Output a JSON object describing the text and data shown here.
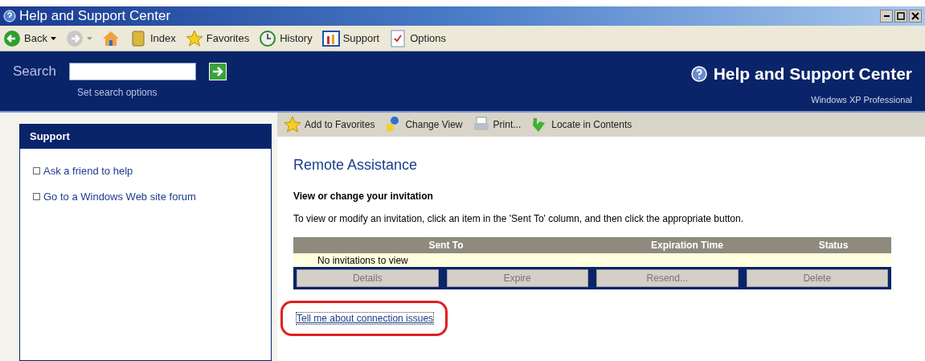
{
  "window": {
    "title": "Help and Support Center"
  },
  "toolbar": [
    {
      "kind": "back",
      "label": "Back",
      "disabled": false
    },
    {
      "kind": "forward",
      "disabled": true
    },
    {
      "kind": "home",
      "disabled": false
    },
    {
      "kind": "index",
      "label": "Index",
      "disabled": false
    },
    {
      "kind": "favorites",
      "label": "Favorites",
      "disabled": false
    },
    {
      "kind": "history",
      "label": "History",
      "disabled": false
    },
    {
      "kind": "support",
      "label": "Support",
      "disabled": false
    },
    {
      "kind": "options",
      "label": "Options",
      "disabled": false
    }
  ],
  "search": {
    "label": "Search",
    "options_link": "Set search options"
  },
  "brand": {
    "title": "Help and Support Center",
    "subtitle": "Windows XP Professional"
  },
  "sidebar": {
    "title": "Support",
    "items": [
      "Ask a friend to help",
      "Go to a Windows Web site forum"
    ]
  },
  "content_toolbar": [
    {
      "kind": "add-favorite",
      "label": "Add to Favorites"
    },
    {
      "kind": "change-view",
      "label": "Change View"
    },
    {
      "kind": "print",
      "label": "Print..."
    },
    {
      "kind": "locate",
      "label": "Locate in Contents"
    }
  ],
  "page": {
    "title": "Remote Assistance",
    "subtitle": "View or change your invitation",
    "instructions": "To view or modify an invitation, click an item in the 'Sent To' column, and then click the appropriate button.",
    "table": {
      "columns": [
        "Sent To",
        "Expiration Time",
        "Status"
      ],
      "empty_message": "No invitations to view"
    },
    "buttons": [
      {
        "label": "Details",
        "disabled": true
      },
      {
        "label": "Expire",
        "disabled": true
      },
      {
        "label": "Resend...",
        "disabled": true
      },
      {
        "label": "Delete",
        "disabled": true
      }
    ],
    "link": "Tell me about connection issues",
    "link_highlighted": true
  }
}
